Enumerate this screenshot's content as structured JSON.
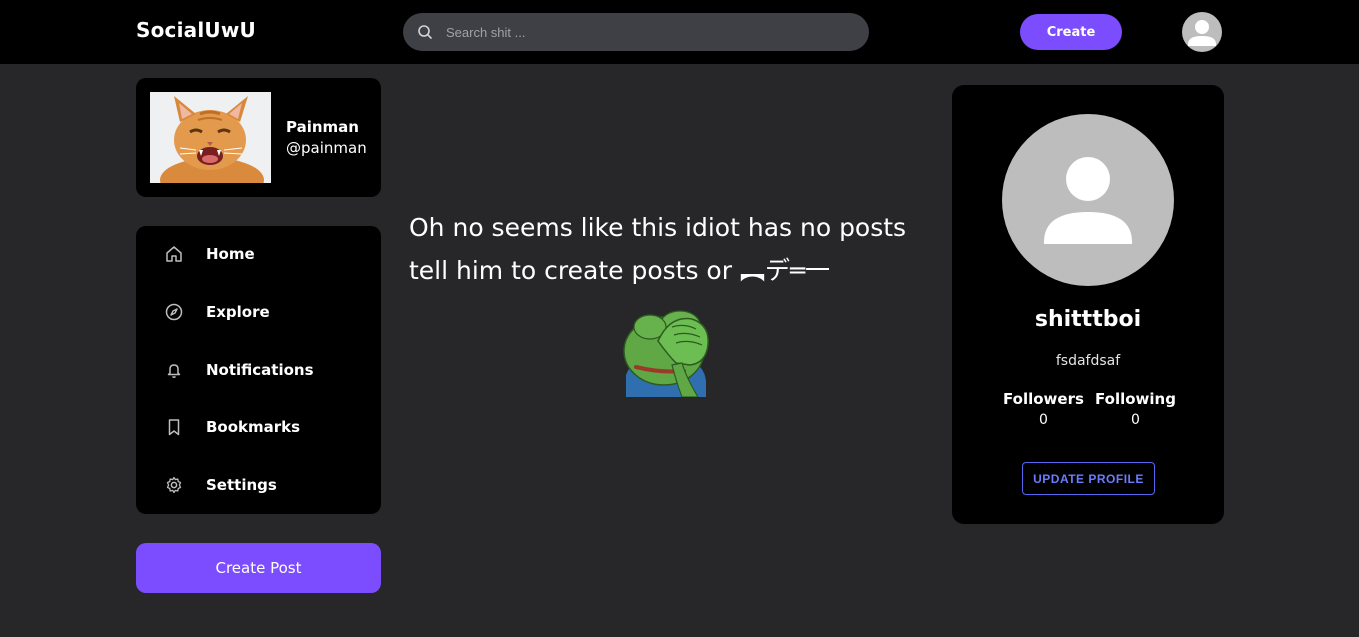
{
  "header": {
    "brand": "SocialUwU",
    "search_placeholder": "Search shit ...",
    "create_label": "Create",
    "avatar_icon": "user-avatar-icon"
  },
  "profile_card": {
    "name": "Painman",
    "handle": "@painman"
  },
  "nav": {
    "items": [
      {
        "label": "Home",
        "icon": "home-icon"
      },
      {
        "label": "Explore",
        "icon": "compass-icon"
      },
      {
        "label": "Notifications",
        "icon": "bell-icon"
      },
      {
        "label": "Bookmarks",
        "icon": "bookmark-icon"
      },
      {
        "label": "Settings",
        "icon": "gear-icon"
      }
    ]
  },
  "create_post_label": "Create Post",
  "main": {
    "empty_message": "Oh no seems like this idiot has no posts tell him to create posts or ︻デ═一"
  },
  "right_card": {
    "username": "shitttboi",
    "bio": "fsdafdsaf",
    "followers_label": "Followers",
    "followers_count": "0",
    "following_label": "Following",
    "following_count": "0",
    "update_label": "UPDATE PROFILE"
  },
  "colors": {
    "accent": "#7c4dff",
    "background": "#27272a",
    "card": "#000000",
    "outline_button": "#5865f2"
  }
}
